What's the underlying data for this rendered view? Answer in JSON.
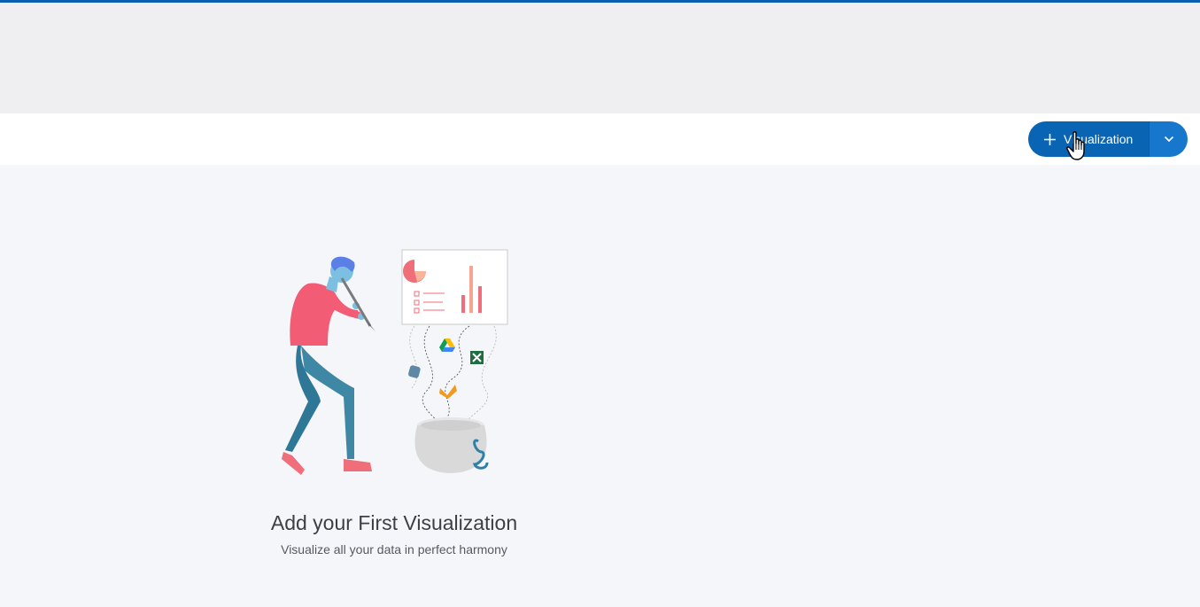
{
  "toolbar": {
    "add_button_label": "Visualization",
    "add_button_icon": "plus-icon",
    "dropdown_icon": "chevron-down-icon"
  },
  "empty_state": {
    "title": "Add your First Visualization",
    "subtitle": "Visualize all your data in perfect harmony",
    "illustration_icons": [
      "google-drive-icon",
      "excel-icon",
      "database-icon",
      "analytics-icon"
    ]
  },
  "colors": {
    "accent": "#0b5fae",
    "button_primary": "#0a64b4",
    "button_secondary": "#1677cc",
    "page_bg": "#f5f6fa",
    "header_bg": "#efeff1"
  }
}
